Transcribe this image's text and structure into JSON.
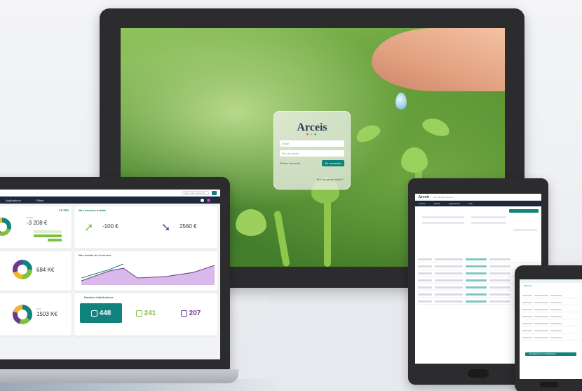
{
  "monitor": {
    "login": {
      "brand": "Arceis",
      "username_placeholder": "Email",
      "password_placeholder": "Mot de passe",
      "stay_logged": "Rester connecté",
      "login_button": "Se connecter",
      "forgot": "Mot de passe oublié ?"
    }
  },
  "laptop": {
    "search_placeholder": "Saisir votre recherche",
    "nav": [
      "Applications",
      "Filtres"
    ],
    "card1": {
      "label": "Budget",
      "value": "-3 208 €",
      "header": "FILTER"
    },
    "card2": {
      "title": "Mes derniers Achats",
      "left_value": "-100 €",
      "right_value": "2560 €"
    },
    "card3": {
      "value": "684 K€"
    },
    "card4": {
      "title": "Mes achats de l'exercice"
    },
    "card5": {
      "value": "1503 K€",
      "label": "Total"
    },
    "card6": {
      "title": "Nombre d'attributions",
      "kpis": [
        {
          "value": "448",
          "color": "#ffffff",
          "bg": "#12837c"
        },
        {
          "value": "241",
          "color": "#7fc243",
          "bg": "#ffffff"
        },
        {
          "value": "207",
          "color": "#6a3a8f",
          "bg": "#ffffff"
        }
      ]
    }
  },
  "tablet": {
    "brand": "Arceis",
    "header_text": "Mon tableau d'Achat",
    "nav": [
      "Accueil",
      "Achats",
      "Applications",
      "Aide"
    ],
    "action_button": "Enregistrer les modifications"
  },
  "phone": {
    "header": "Résumé",
    "button": "Enregistrer les modifications"
  },
  "colors": {
    "teal": "#12837c",
    "navy": "#1e2a3c",
    "purple": "#6a3a8f",
    "green": "#7fc243",
    "device": "#2c2b2d"
  }
}
